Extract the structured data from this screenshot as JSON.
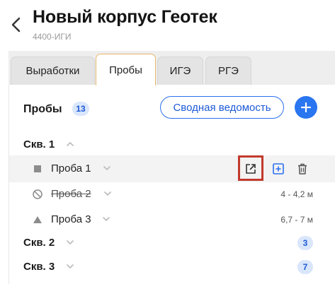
{
  "header": {
    "title": "Новый корпус Геотек",
    "subtitle": "4400-ИГИ"
  },
  "tabs": [
    {
      "label": "Выработки",
      "active": false
    },
    {
      "label": "Пробы",
      "active": true
    },
    {
      "label": "ИГЭ",
      "active": false
    },
    {
      "label": "РГЭ",
      "active": false
    }
  ],
  "section": {
    "title": "Пробы",
    "count": "13",
    "summary_button": "Сводная ведомость"
  },
  "groups": [
    {
      "name": "Скв. 1",
      "expanded": true
    },
    {
      "name": "Скв. 2",
      "count": "3",
      "expanded": false
    },
    {
      "name": "Скв. 3",
      "count": "7",
      "expanded": false
    }
  ],
  "samples": [
    {
      "name": "Проба 1",
      "depth": "",
      "icon": "square-icon",
      "struck": false
    },
    {
      "name": "Проба 2",
      "depth": "4 - 4,2 м",
      "icon": "prohibited-icon",
      "struck": true
    },
    {
      "name": "Проба 3",
      "depth": "6,7 - 7 м",
      "icon": "triangle-icon",
      "struck": false
    }
  ],
  "colors": {
    "accent": "#2a75f0",
    "badge_bg": "#d9e6fb",
    "active_tab_border": "#e9b86b",
    "highlight": "#c23a2c"
  }
}
